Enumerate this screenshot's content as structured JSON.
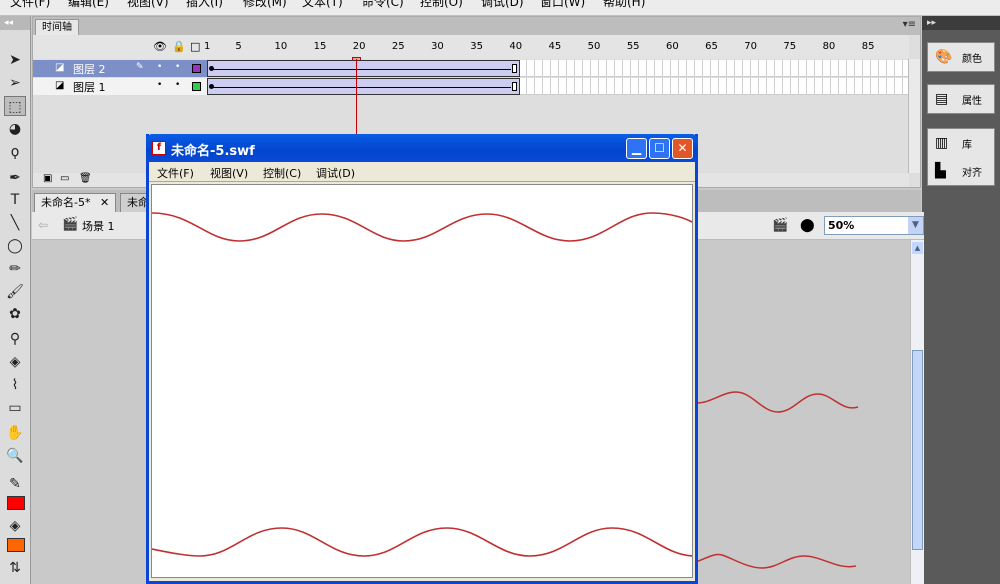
{
  "menubar": [
    "文件(F)",
    "编辑(E)",
    "视图(V)",
    "插入(I)",
    "修改(M)",
    "文本(T)",
    "命令(C)",
    "控制(O)",
    "调试(D)",
    "窗口(W)",
    "帮助(H)"
  ],
  "timeline": {
    "tab": "时间轴",
    "frame_numbers": [
      "1",
      "5",
      "10",
      "15",
      "20",
      "25",
      "30",
      "35",
      "40",
      "45",
      "50",
      "55",
      "60",
      "65",
      "70",
      "75",
      "80",
      "85"
    ],
    "current_frame": 20,
    "layers": [
      {
        "name": "图层 2",
        "selected": true,
        "color": "#9b30c8"
      },
      {
        "name": "图层 1",
        "selected": false,
        "color": "#33cc44"
      }
    ],
    "tween_end_frame": 40
  },
  "document_tabs": {
    "active": "未命名-5*",
    "other": "未命"
  },
  "editbar": {
    "scene": "场景 1",
    "zoom": "50%"
  },
  "right_panel": {
    "items": [
      {
        "label": "颜色",
        "icon": "palette-icon"
      },
      {
        "label": "属性",
        "icon": "properties-icon"
      },
      {
        "label": "库",
        "icon": "library-icon"
      },
      {
        "label": "对齐",
        "icon": "align-icon"
      }
    ]
  },
  "swf_window": {
    "title": "未命名-5.swf",
    "menu": [
      "文件(F)",
      "视图(V)",
      "控制(C)",
      "调试(D)"
    ]
  },
  "colors": {
    "wave": "#c03030",
    "stroke_swatch": "#ff0000",
    "fill_swatch": "#ff6600",
    "selection": "#7c8fc6"
  }
}
